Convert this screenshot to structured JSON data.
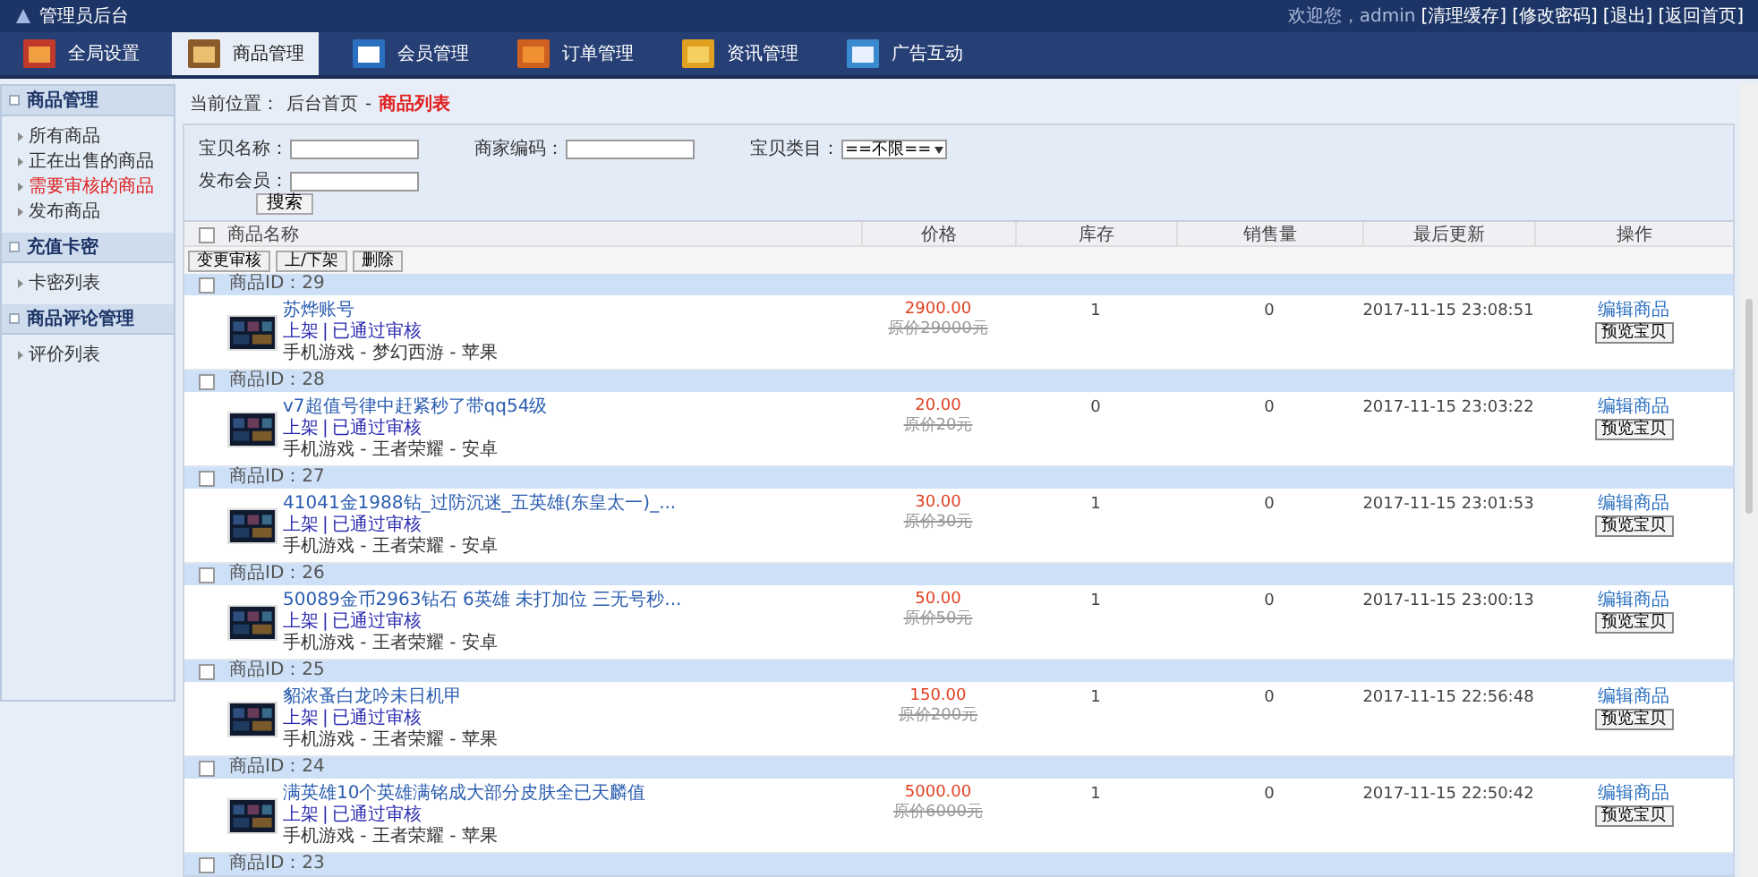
{
  "header": {
    "title": "管理员后台",
    "greeting": "欢迎您，admin",
    "links": [
      "[清理缓存]",
      "[修改密码]",
      "[退出]",
      "[返回首页]"
    ]
  },
  "nav_tabs": [
    {
      "label": "全局设置",
      "selected": false,
      "kind": "settings"
    },
    {
      "label": "商品管理",
      "selected": true,
      "kind": "goods"
    },
    {
      "label": "会员管理",
      "selected": false,
      "kind": "member"
    },
    {
      "label": "订单管理",
      "selected": false,
      "kind": "order"
    },
    {
      "label": "资讯管理",
      "selected": false,
      "kind": "news"
    },
    {
      "label": "广告互动",
      "selected": false,
      "kind": "ad"
    }
  ],
  "sidebar": [
    {
      "title": "商品管理",
      "items": [
        {
          "label": "所有商品",
          "selected": false
        },
        {
          "label": "正在出售的商品",
          "selected": false
        },
        {
          "label": "需要审核的商品",
          "selected": true
        },
        {
          "label": "发布商品",
          "selected": false
        }
      ]
    },
    {
      "title": "充值卡密",
      "items": [
        {
          "label": "卡密列表",
          "selected": false
        }
      ]
    },
    {
      "title": "商品评论管理",
      "items": [
        {
          "label": "评价列表",
          "selected": false
        }
      ]
    }
  ],
  "breadcrumb": {
    "prefix": "当前位置：",
    "home": "后台首页",
    "separator": "-",
    "current": "商品列表"
  },
  "search": {
    "fields": [
      {
        "label": "宝贝名称：",
        "kind": "input"
      },
      {
        "label": "商家编码：",
        "kind": "input"
      },
      {
        "label": "宝贝类目：",
        "kind": "select",
        "value": "==不限=="
      },
      {
        "label": "发布会员：",
        "kind": "input"
      }
    ],
    "button": "搜索"
  },
  "table": {
    "select_all": {
      "checked": false
    },
    "columns": [
      "商品名称",
      "价格",
      "库存",
      "销售量",
      "最后更新",
      "操作"
    ],
    "status_separator": "|",
    "bulk_actions": [
      "变更审核",
      "上/下架",
      "删除"
    ],
    "rows": [
      {
        "id_label": "商品ID：29",
        "checked": false,
        "title": "苏烨账号",
        "status": "上架",
        "review": "已通过审核",
        "category": "手机游戏 - 梦幻西游 - 苹果",
        "price": "2900.00",
        "original_price": "原价29000元",
        "stock": "1",
        "sales": "0",
        "updated": "2017-11-15 23:08:51",
        "edit": "编辑商品",
        "preview": "预览宝贝"
      },
      {
        "id_label": "商品ID：28",
        "checked": false,
        "title": "v7超值号律中赶紧秒了带qq54级",
        "status": "上架",
        "review": "已通过审核",
        "category": "手机游戏 - 王者荣耀 - 安卓",
        "price": "20.00",
        "original_price": "原价20元",
        "stock": "0",
        "sales": "0",
        "updated": "2017-11-15 23:03:22",
        "edit": "编辑商品",
        "preview": "预览宝贝"
      },
      {
        "id_label": "商品ID：27",
        "checked": false,
        "title": "41041金1988钻_过防沉迷_五英雄(东皇太一)_...",
        "status": "上架",
        "review": "已通过审核",
        "category": "手机游戏 - 王者荣耀 - 安卓",
        "price": "30.00",
        "original_price": "原价30元",
        "stock": "1",
        "sales": "0",
        "updated": "2017-11-15 23:01:53",
        "edit": "编辑商品",
        "preview": "预览宝贝"
      },
      {
        "id_label": "商品ID：26",
        "checked": false,
        "title": "50089金币2963钻石 6英雄 未打加位 三无号秒...",
        "status": "上架",
        "review": "已通过审核",
        "category": "手机游戏 - 王者荣耀 - 安卓",
        "price": "50.00",
        "original_price": "原价50元",
        "stock": "1",
        "sales": "0",
        "updated": "2017-11-15 23:00:13",
        "edit": "编辑商品",
        "preview": "预览宝贝"
      },
      {
        "id_label": "商品ID：25",
        "checked": false,
        "title": "貂浓蚤白龙吟未日机甲",
        "status": "上架",
        "review": "已通过审核",
        "category": "手机游戏 - 王者荣耀 - 苹果",
        "price": "150.00",
        "original_price": "原价200元",
        "stock": "1",
        "sales": "0",
        "updated": "2017-11-15 22:56:48",
        "edit": "编辑商品",
        "preview": "预览宝贝"
      },
      {
        "id_label": "商品ID：24",
        "checked": false,
        "title": "满英雄10个英雄满铭成大部分皮肤全已天麟值",
        "status": "上架",
        "review": "已通过审核",
        "category": "手机游戏 - 王者荣耀 - 苹果",
        "price": "5000.00",
        "original_price": "原价6000元",
        "stock": "1",
        "sales": "0",
        "updated": "2017-11-15 22:50:42",
        "edit": "编辑商品",
        "preview": "预览宝贝"
      }
    ],
    "partial_row": {
      "id_label": "商品ID：23",
      "checked": false
    }
  }
}
